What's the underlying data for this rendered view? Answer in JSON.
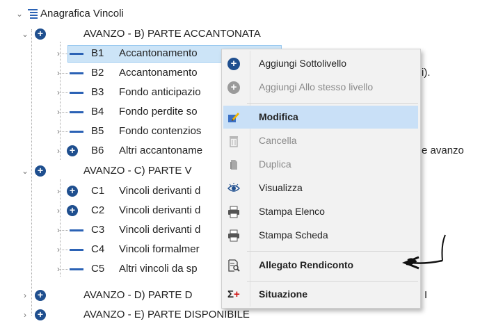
{
  "tree": {
    "root": {
      "label": "Anagrafica Vincoli"
    },
    "nodes": [
      {
        "label": "AVANZO - B) PARTE ACCANTONATA"
      },
      {
        "code": "B1",
        "label": "Accantonamento"
      },
      {
        "code": "B2",
        "label": "Accantonamento"
      },
      {
        "code": "B3",
        "label": "Fondo anticipazio"
      },
      {
        "code": "B4",
        "label": "Fondo perdite so"
      },
      {
        "code": "B5",
        "label": "Fondo contenzios"
      },
      {
        "code": "B6",
        "label": "Altri accantoname"
      },
      {
        "label": "AVANZO - C) PARTE V"
      },
      {
        "code": "C1",
        "label": "Vincoli derivanti d"
      },
      {
        "code": "C2",
        "label": "Vincoli derivanti d"
      },
      {
        "code": "C3",
        "label": "Vincoli derivanti d"
      },
      {
        "code": "C4",
        "label": "Vincoli formalmer"
      },
      {
        "code": "C5",
        "label": "Altri vincoli da sp"
      },
      {
        "label": "AVANZO - D) PARTE D"
      },
      {
        "label": "AVANZO - E) PARTE DISPONIBILE"
      }
    ],
    "overflow": {
      "b2_tail": "i).",
      "b6_tail": "e avanzo",
      "d_tail": "I"
    }
  },
  "context_menu": {
    "items": [
      {
        "label": "Aggiungi Sottolivello",
        "icon": "plus-circle-icon",
        "enabled": true
      },
      {
        "label": "Aggiungi Allo stesso livello",
        "icon": "plus-circle-icon",
        "enabled": false
      },
      {
        "label": "Modifica",
        "icon": "edit-pencil-icon",
        "enabled": true,
        "highlighted": true
      },
      {
        "label": "Cancella",
        "icon": "trash-icon",
        "enabled": false
      },
      {
        "label": "Duplica",
        "icon": "duplicate-icon",
        "enabled": false
      },
      {
        "label": "Visualizza",
        "icon": "eye-icon",
        "enabled": true
      },
      {
        "label": "Stampa Elenco",
        "icon": "printer-icon",
        "enabled": true
      },
      {
        "label": "Stampa Scheda",
        "icon": "printer-icon",
        "enabled": true
      },
      {
        "label": "Allegato Rendiconto",
        "icon": "report-magnify-icon",
        "enabled": true
      },
      {
        "label": "Situazione",
        "icon": "sigma-plus-icon",
        "enabled": true
      }
    ]
  },
  "colors": {
    "selection": "#cce4f7",
    "menu_highlight": "#c9e0f7",
    "node_plus": "#1f4f8f",
    "leaf_dash": "#2b62b5"
  }
}
